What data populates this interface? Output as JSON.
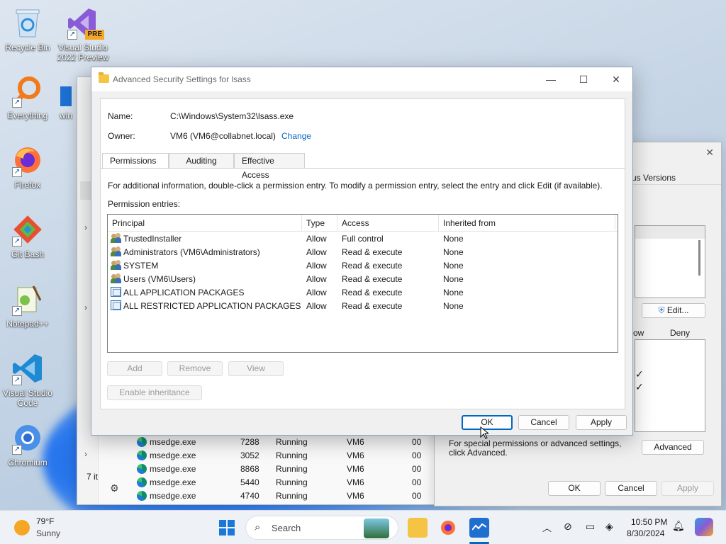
{
  "desktop": {
    "icons": [
      {
        "label": "Recycle Bin"
      },
      {
        "label": "Visual Studio 2022 Preview",
        "badge": "PRE"
      },
      {
        "label": "Everything"
      },
      {
        "label": "win"
      },
      {
        "label": "Firefox"
      },
      {
        "label": "Git Bash"
      },
      {
        "label": "Notepad++"
      },
      {
        "label": "Visual Studio Code"
      },
      {
        "label": "Chromium"
      }
    ]
  },
  "dialog": {
    "title": "Advanced Security Settings for lsass",
    "controls": {
      "minimize": "—",
      "maximize": "☐",
      "close": "✕"
    },
    "name_label": "Name:",
    "name_value": "C:\\Windows\\System32\\lsass.exe",
    "owner_label": "Owner:",
    "owner_value": "VM6 (VM6@collabnet.local)",
    "change_link": "Change",
    "tabs": [
      "Permissions",
      "Auditing",
      "Effective Access"
    ],
    "info_text": "For additional information, double-click a permission entry. To modify a permission entry, select the entry and click Edit (if available).",
    "entries_label": "Permission entries:",
    "columns": [
      "Principal",
      "Type",
      "Access",
      "Inherited from"
    ],
    "rows": [
      {
        "principal": "TrustedInstaller",
        "type": "Allow",
        "access": "Full control",
        "inherited": "None",
        "icon": "users-icon"
      },
      {
        "principal": "Administrators (VM6\\Administrators)",
        "type": "Allow",
        "access": "Read & execute",
        "inherited": "None",
        "icon": "users-icon"
      },
      {
        "principal": "SYSTEM",
        "type": "Allow",
        "access": "Read & execute",
        "inherited": "None",
        "icon": "users-icon"
      },
      {
        "principal": "Users (VM6\\Users)",
        "type": "Allow",
        "access": "Read & execute",
        "inherited": "None",
        "icon": "users-icon"
      },
      {
        "principal": "ALL APPLICATION PACKAGES",
        "type": "Allow",
        "access": "Read & execute",
        "inherited": "None",
        "icon": "package-icon"
      },
      {
        "principal": "ALL RESTRICTED APPLICATION PACKAGES",
        "type": "Allow",
        "access": "Read & execute",
        "inherited": "None",
        "icon": "package-icon"
      }
    ],
    "buttons": {
      "add": "Add",
      "remove": "Remove",
      "view": "View",
      "enable_inheritance": "Enable inheritance",
      "ok": "OK",
      "cancel": "Cancel",
      "apply": "Apply"
    }
  },
  "task_manager": {
    "items_count": "7 it",
    "processes": [
      {
        "name": "msedge.exe",
        "pid": "7288",
        "status": "Running",
        "user": "VM6",
        "cpu": "00"
      },
      {
        "name": "msedge.exe",
        "pid": "3052",
        "status": "Running",
        "user": "VM6",
        "cpu": "00"
      },
      {
        "name": "msedge.exe",
        "pid": "8868",
        "status": "Running",
        "user": "VM6",
        "cpu": "00"
      },
      {
        "name": "msedge.exe",
        "pid": "5440",
        "status": "Running",
        "user": "VM6",
        "cpu": "00"
      },
      {
        "name": "msedge.exe",
        "pid": "4740",
        "status": "Running",
        "user": "VM6",
        "cpu": "00"
      }
    ]
  },
  "properties": {
    "tab_partial": "us Versions",
    "edit_button": "Edit...",
    "col_allow_partial": "ow",
    "col_deny": "Deny",
    "special_text": "For special permissions or advanced settings, click Advanced.",
    "advanced_button": "Advanced",
    "ok": "OK",
    "cancel": "Cancel",
    "apply": "Apply"
  },
  "taskbar": {
    "weather_temp": "79°F",
    "weather_desc": "Sunny",
    "search_placeholder": "Search",
    "time": "10:50 PM",
    "date": "8/30/2024"
  },
  "colors": {
    "accent": "#0067c0",
    "link": "#0a64c2"
  }
}
